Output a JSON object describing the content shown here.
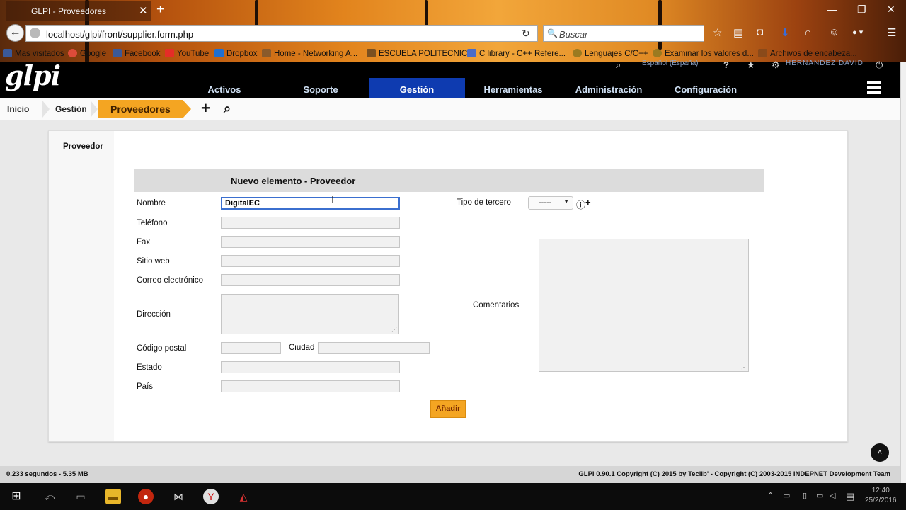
{
  "browser": {
    "tab_title": "GLPI - Proveedores",
    "url": "localhost/glpi/front/supplier.form.php",
    "search_placeholder": "Buscar",
    "bookmarks": [
      "Mas visitados",
      "Google",
      "Facebook",
      "YouTube",
      "Dropbox",
      "Home - Networking A...",
      "ESCUELA POLITECNIC...",
      "C library - C++ Refere...",
      "Lenguajes C/C++",
      "Examinar los valores d...",
      "Archivos de encabeza..."
    ],
    "bookmark_colors": [
      "#3b5998",
      "#dd4b39",
      "#3b5998",
      "#e52d27",
      "#1f6fd1",
      "#8a5a2b",
      "#7a5020",
      "#4a6cc7",
      "#9a7a20",
      "#9a7a20",
      "#8a4a1a"
    ]
  },
  "glpi": {
    "logo": "glpi",
    "lang": "Español (España)",
    "user": "HERNANDEZ DAVID",
    "menu": [
      "Activos",
      "Soporte",
      "Gestión",
      "Herramientas",
      "Administración",
      "Configuración"
    ],
    "active_menu": "Gestión",
    "accent": "#0e3bb0",
    "breadcrumb": [
      "Inicio",
      "Gestión",
      "Proveedores"
    ]
  },
  "form": {
    "side_tab": "Proveedor",
    "title": "Nuevo elemento - Proveedor",
    "labels": {
      "nombre": "Nombre",
      "telefono": "Teléfono",
      "fax": "Fax",
      "sitio_web": "Sitio web",
      "correo": "Correo electrónico",
      "direccion": "Dirección",
      "codigo_postal": "Código postal",
      "ciudad": "Ciudad",
      "estado": "Estado",
      "pais": "País",
      "tipo_tercero": "Tipo de tercero",
      "comentarios": "Comentarios"
    },
    "values": {
      "nombre": "DigitalEC",
      "tipo_tercero": "-----"
    },
    "submit": "Añadir",
    "submit_color": "#f4a522"
  },
  "footer": {
    "left": "0.233 segundos - 5.35 MB",
    "right": "GLPI 0.90.1 Copyright (C) 2015 by Teclib' - Copyright (C) 2003-2015 INDEPNET Development Team"
  },
  "taskbar": {
    "time": "12:40",
    "date": "25/2/2016"
  }
}
